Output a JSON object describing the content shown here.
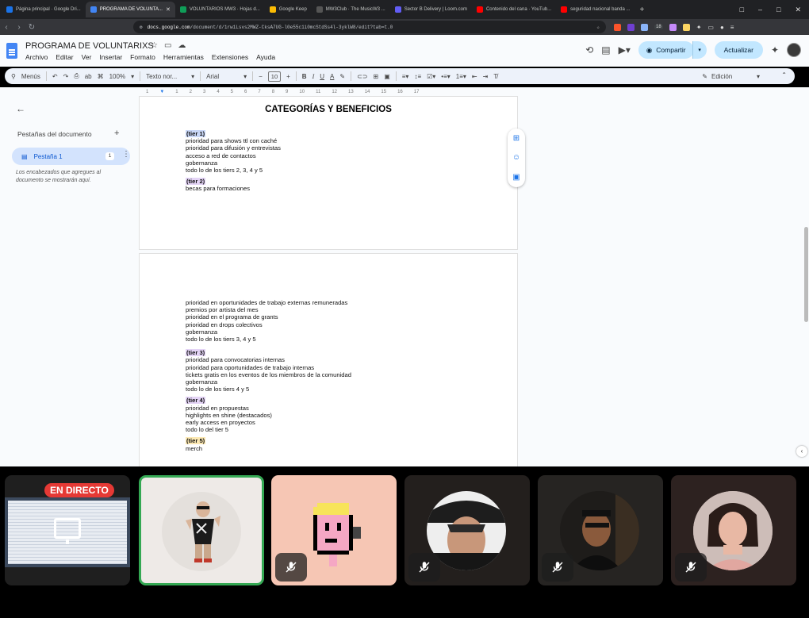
{
  "browser": {
    "tabs": [
      {
        "label": "Página principal · Google Dri...",
        "color": "#1a73e8",
        "active": false
      },
      {
        "label": "PROGRAMA DE VOLUNTA...",
        "color": "#4285f4",
        "active": true
      },
      {
        "label": "VOLUNTARIOS MW3 · Hojas d...",
        "color": "#0f9d58",
        "active": false
      },
      {
        "label": "Google Keep",
        "color": "#fbbc04",
        "active": false
      },
      {
        "label": "MW3Club · The MusicW3 ...",
        "color": "#222222",
        "active": false
      },
      {
        "label": "Sector B Delivery | Loom.com",
        "color": "#625df5",
        "active": false
      },
      {
        "label": "Contenido del cana · YouTub...",
        "color": "#ff0000",
        "active": false
      },
      {
        "label": "seguridad nacional banda ...",
        "color": "#ff0000",
        "active": false
      }
    ],
    "new_tab": "+",
    "window_controls": [
      "□",
      "–",
      "□",
      "✕"
    ],
    "url_host": "docs.google.com",
    "url_path": "/document/d/1rw1Lsvs2MWZ-CksA7UG-l0e55c1i0mcStdSs4l-3yklW8/edit?tab=t.0",
    "extension_badge": "18"
  },
  "docs": {
    "title": "PROGRAMA DE VOLUNTARIXS",
    "menu": [
      "Archivo",
      "Editar",
      "Ver",
      "Insertar",
      "Formato",
      "Herramientas",
      "Extensiones",
      "Ayuda"
    ],
    "share_label": "Compartir",
    "update_label": "Actualizar"
  },
  "toolbar": {
    "menus_label": "Menús",
    "zoom": "100%",
    "style": "Texto nor...",
    "font": "Arial",
    "font_size": "10",
    "edit_mode": "Edición"
  },
  "sidebar": {
    "header": "Pestañas del documento",
    "tab_label": "Pestaña 1",
    "tab_badge": "1",
    "hint": "Los encabezados que agregues al documento se mostrarán aquí."
  },
  "ruler_marks": [
    "1",
    "1",
    "2",
    "3",
    "4",
    "5",
    "6",
    "7",
    "8",
    "9",
    "10",
    "11",
    "12",
    "13",
    "14",
    "15",
    "16",
    "17",
    "18"
  ],
  "document": {
    "heading": "CATEGORÍAS Y BENEFICIOS",
    "page1": {
      "tier1_label": "(tier 1)",
      "tier1_lines": [
        "prioridad para shows ttl con caché",
        "prioridad para difusión y entrevistas",
        "acceso a red de contactos",
        "gobernanza",
        "todo lo de los tiers 2, 3, 4 y 5"
      ],
      "tier2_label": "(tier 2)",
      "tier2_lines": [
        "becas para formaciones"
      ]
    },
    "page2": {
      "cont_lines": [
        "prioridad en oportunidades de trabajo externas remuneradas",
        "premios por artista del mes",
        "prioridad en el programa de grants",
        "prioridad en drops colectivos",
        "gobernanza",
        "todo lo de los tiers 3, 4 y 5"
      ],
      "tier3_label": "(tier 3)",
      "tier3_lines": [
        "prioridad para convocatorias internas",
        "prioridad para oportunidades de trabajo internas",
        "tickets gratis en los eventos de los miembros de la comunidad",
        "gobernanza",
        "todo lo de los tiers 4 y 5"
      ],
      "tier4_label": "(tier 4)",
      "tier4_lines": [
        "prioridad en propuestas",
        "highlights en shine (destacados)",
        "early access en proyectos",
        "todo lo del tier 5"
      ],
      "tier5_label": "(tier 5)",
      "tier5_lines": [
        "merch"
      ]
    }
  },
  "meeting": {
    "live_label": "EN DIRECTO",
    "tiles": [
      {
        "kind": "screen",
        "bg": "#1f1f1f"
      },
      {
        "kind": "person",
        "bg": "#eeeae7",
        "muted": false,
        "speaking": true
      },
      {
        "kind": "person",
        "bg": "#f6c6b4",
        "muted": true
      },
      {
        "kind": "person",
        "bg": "#231f1d",
        "muted": true
      },
      {
        "kind": "person",
        "bg": "#262422",
        "muted": true
      },
      {
        "kind": "person",
        "bg": "#2d2220",
        "muted": true
      }
    ]
  }
}
